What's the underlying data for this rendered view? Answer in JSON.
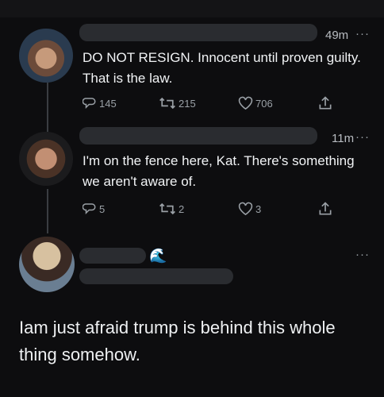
{
  "tweets": [
    {
      "time": "49m",
      "text": "DO NOT RESIGN. Innocent until proven guilty. That is the law.",
      "replies": "145",
      "retweets": "215",
      "likes": "706"
    },
    {
      "time": "11m",
      "text": "I'm on the fence here, Kat. There's something we aren't aware of.",
      "replies": "5",
      "retweets": "2",
      "likes": "3"
    }
  ],
  "main_tweet": {
    "emoji": "🌊",
    "text": "Iam just afraid trump is behind this whole thing somehow."
  },
  "icons": {
    "more": "more-icon",
    "reply": "reply-icon",
    "retweet": "retweet-icon",
    "like": "heart-icon",
    "share": "share-icon"
  },
  "more_glyph": "···"
}
